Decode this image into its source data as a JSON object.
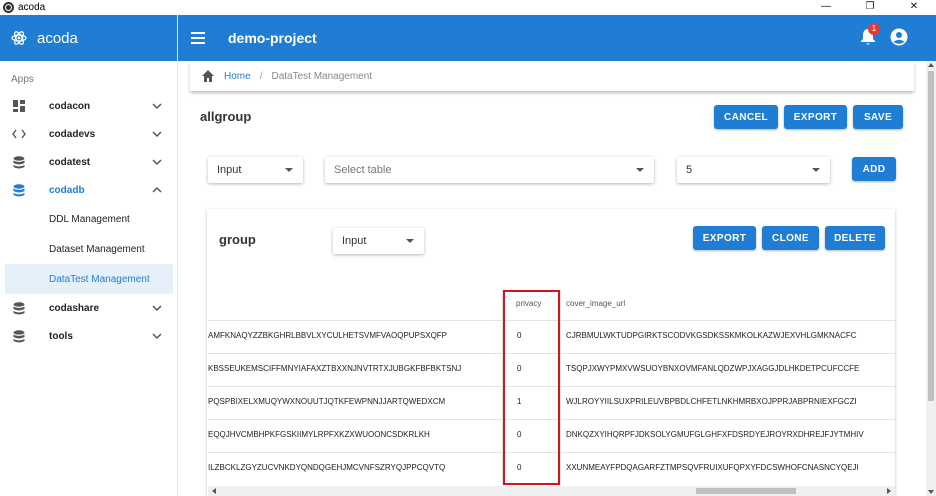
{
  "window": {
    "title": "acoda",
    "minimize": "—",
    "restore": "❐",
    "close": "✕"
  },
  "sidebar": {
    "brand": "acoda",
    "section": "Apps",
    "items": [
      {
        "label": "codacon",
        "icon": "dashboard-icon"
      },
      {
        "label": "codadevs",
        "icon": "code-icon"
      },
      {
        "label": "codatest",
        "icon": "database-icon"
      },
      {
        "label": "codadb",
        "icon": "database-icon"
      },
      {
        "label": "codashare",
        "icon": "database-icon"
      },
      {
        "label": "tools",
        "icon": "database-icon"
      }
    ],
    "subitems": [
      "DDL Management",
      "Dataset Management",
      "DataTest Management"
    ],
    "colors": {
      "accent": "#1f7ed4",
      "selected_bg": "#e6f0fa"
    }
  },
  "appbar": {
    "project": "demo-project",
    "notification_count": "1"
  },
  "breadcrumb": {
    "home": "Home",
    "separator": "/",
    "current": "DataTest Management"
  },
  "page": {
    "title": "allgroup",
    "actions": {
      "cancel": "CANCEL",
      "export": "EXPORT",
      "save": "SAVE"
    },
    "filters": {
      "type_value": "Input",
      "table_placeholder": "Select table",
      "count_value": "5",
      "add": "ADD"
    }
  },
  "group": {
    "title": "group",
    "type_value": "Input",
    "actions": {
      "export": "EXPORT",
      "clone": "CLONE",
      "delete": "DELETE"
    },
    "table": {
      "columns": [
        "privacy",
        "cover_image_url"
      ],
      "rows": [
        {
          "partial": "AMFKNAQYZZBKGHRLBBVLXYCULHETSVMFVAOQPUPSXQFP",
          "privacy": "0",
          "cover_image_url": "CJRBMULWKTUDPGIRKTSCODVKGSDKSSKMKOLKAZWJEXVHLGMKNACFC"
        },
        {
          "partial": "KBSSEUKEMSCIFFMNYIAFAXZTBXXNJNVTRTXJUBGKFBFBKTSNJ",
          "privacy": "0",
          "cover_image_url": "TSQPJXWYPMXVWSUOYBNXOVMFANLQDZWPJXAGGJDLHKDETPCUFCCFE"
        },
        {
          "partial": "PQSPBIXELXMUQYWXNOUUTJQTKFEWPNNJJARTQWEDXCM",
          "privacy": "1",
          "cover_image_url": "WJLROYYIILSUXPRILEUVBPBDLCHFETLNKHMRBXOJPPRJABPRNIEXFGCZI"
        },
        {
          "partial": "EQQJHVCMBHPKFGSKIIMYLRPFXKZXWUOONCSDKRLKH",
          "privacy": "0",
          "cover_image_url": "DNKQZXYIHQRPFJDKSOLYGMUFGLGHFXFDSRDYEJROYRXDHREJFJYTMHIV"
        },
        {
          "partial": "ILZBCKLZGYZUCVNKDYQNDQGEHJMCVNFSZRYQJPPCQVTQ",
          "privacy": "0",
          "cover_image_url": "XXUNMEAYFPDQAGARFZTMPSQVFRUIXUFQPXYFDCSWHOFCNASNCYQEJI"
        }
      ]
    },
    "highlight_color": "#d0161c"
  }
}
